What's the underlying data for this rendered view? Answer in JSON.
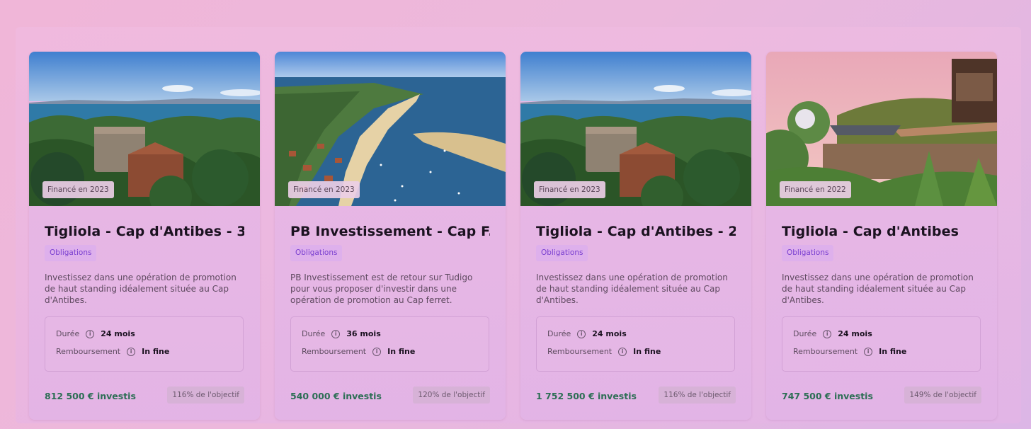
{
  "cards": [
    {
      "image": "antibes-tower-aerial",
      "financed": "Financé en 2023",
      "title": "Tigliola - Cap d'Antibes - 3...",
      "tag": "Obligations",
      "description": "Investissez dans une opération de promotion de haut standing idéalement située au Cap d'Antibes.",
      "duration_label": "Durée",
      "duration_value": "24 mois",
      "repayment_label": "Remboursement",
      "repayment_value": "In fine",
      "invested": "812 500 € investis",
      "goal": "116% de l'objectif"
    },
    {
      "image": "cap-ferret-aerial",
      "financed": "Financé en 2023",
      "title": "PB Investissement - Cap F...",
      "tag": "Obligations",
      "description": "PB Investissement est de retour sur Tudigo pour vous proposer d'investir dans une opération de promotion au Cap ferret.",
      "duration_label": "Durée",
      "duration_value": "36 mois",
      "repayment_label": "Remboursement",
      "repayment_value": "In fine",
      "invested": "540 000 € investis",
      "goal": "120% de l'objectif"
    },
    {
      "image": "antibes-tower-aerial",
      "financed": "Financé en 2023",
      "title": "Tigliola - Cap d'Antibes - 2...",
      "tag": "Obligations",
      "description": "Investissez dans une opération de promotion de haut standing idéalement située au Cap d'Antibes.",
      "duration_label": "Durée",
      "duration_value": "24 mois",
      "repayment_label": "Remboursement",
      "repayment_value": "In fine",
      "invested": "1 752 500 € investis",
      "goal": "116% de l'objectif"
    },
    {
      "image": "terrace-garden-sunset",
      "financed": "Financé en 2022",
      "title": "Tigliola - Cap d'Antibes",
      "tag": "Obligations",
      "description": "Investissez dans une opération de promotion de haut standing idéalement située au Cap d'Antibes.",
      "duration_label": "Durée",
      "duration_value": "24 mois",
      "repayment_label": "Remboursement",
      "repayment_value": "In fine",
      "invested": "747 500 € investis",
      "goal": "149% de l'objectif"
    }
  ],
  "icons": {
    "info": "info-circle-icon"
  },
  "colors": {
    "accent_tag": "#7a3fd0",
    "invested_green": "#2d6e55"
  }
}
